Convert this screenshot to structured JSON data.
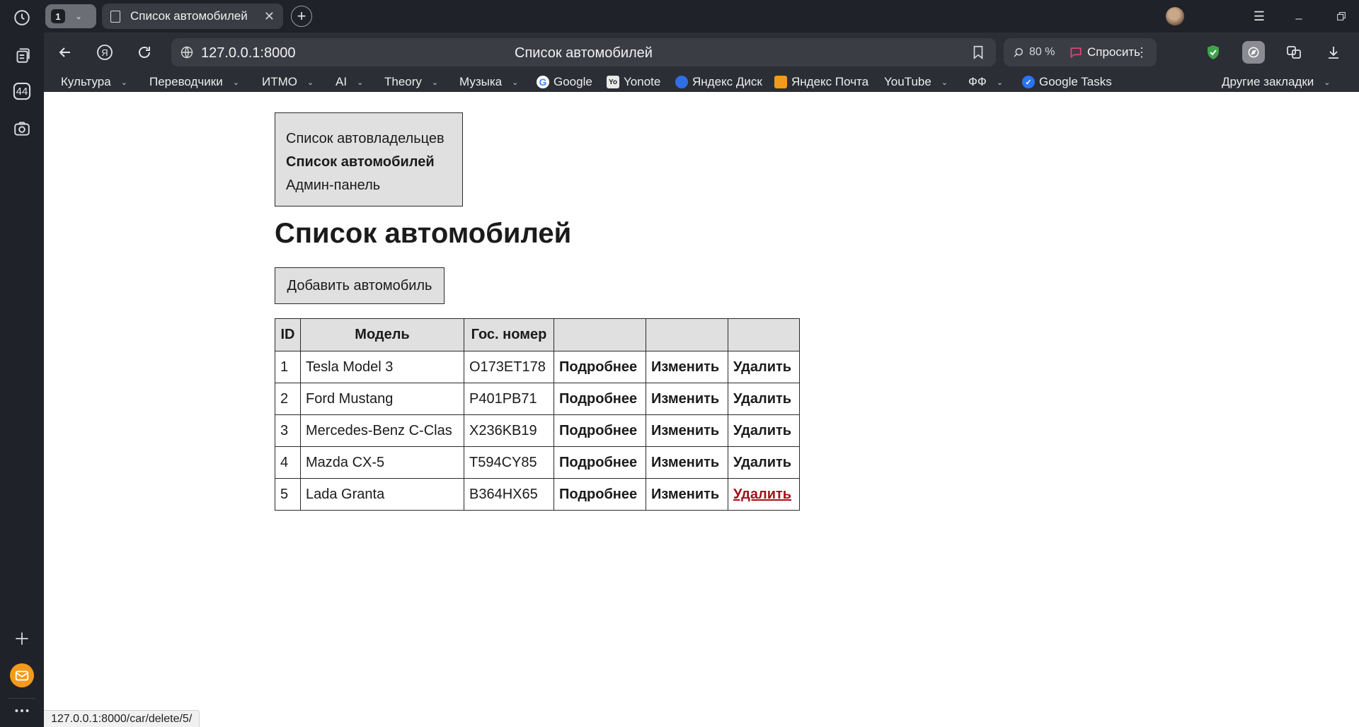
{
  "browser": {
    "tab_count": "1",
    "tab_title": "Список автомобилей",
    "url": "127.0.0.1:8000",
    "page_title": "Список автомобилей",
    "zoom": "80 %",
    "ask_label": "Спросить",
    "sidebar_badge": "44",
    "accent_colors": {
      "chrome_bg": "#202229",
      "toolbar_bg": "#2c2e35",
      "ask_pink": "#e8427a",
      "shield_green": "#3fa34d"
    }
  },
  "bookmarks": [
    {
      "label": "Культура",
      "folder": true
    },
    {
      "label": "Переводчики",
      "folder": true
    },
    {
      "label": "ИТМО",
      "folder": true
    },
    {
      "label": "AI",
      "folder": true
    },
    {
      "label": "Theory",
      "folder": true
    },
    {
      "label": "Музыка",
      "folder": true
    },
    {
      "label": "Google",
      "folder": false,
      "icon": "google-icon"
    },
    {
      "label": "Yonote",
      "folder": false,
      "icon": "yonote-icon"
    },
    {
      "label": "Яндекс Диск",
      "folder": false,
      "icon": "yandex-disk-icon"
    },
    {
      "label": "Яндекс Почта",
      "folder": false,
      "icon": "yandex-mail-icon"
    },
    {
      "label": "YouTube",
      "folder": true
    },
    {
      "label": "ФФ",
      "folder": true
    },
    {
      "label": "Google Tasks",
      "folder": false,
      "icon": "google-tasks-icon"
    },
    {
      "label": "Другие закладки",
      "folder": true
    }
  ],
  "page": {
    "nav": [
      {
        "label": "Список автовладельцев",
        "active": false
      },
      {
        "label": "Список автомобилей",
        "active": true
      },
      {
        "label": "Админ-панель",
        "active": false
      }
    ],
    "heading": "Список автомобилей",
    "add_button": "Добавить автомобиль",
    "table": {
      "headers": [
        "ID",
        "Модель",
        "Гос. номер",
        "",
        "",
        ""
      ],
      "rows": [
        {
          "id": "1",
          "model": "Tesla Model 3",
          "plate": "O173ET178",
          "details": "Подробнее",
          "edit": "Изменить",
          "delete": "Удалить"
        },
        {
          "id": "2",
          "model": "Ford Mustang",
          "plate": "P401PB71",
          "details": "Подробнее",
          "edit": "Изменить",
          "delete": "Удалить"
        },
        {
          "id": "3",
          "model": "Mercedes-Benz C-Clas",
          "plate": "X236KB19",
          "details": "Подробнее",
          "edit": "Изменить",
          "delete": "Удалить"
        },
        {
          "id": "4",
          "model": "Mazda CX-5",
          "plate": "T594CY85",
          "details": "Подробнее",
          "edit": "Изменить",
          "delete": "Удалить"
        },
        {
          "id": "5",
          "model": "Lada Granta",
          "plate": "B364HX65",
          "details": "Подробнее",
          "edit": "Изменить",
          "delete": "Удалить"
        }
      ]
    }
  },
  "status_bar": "127.0.0.1:8000/car/delete/5/"
}
